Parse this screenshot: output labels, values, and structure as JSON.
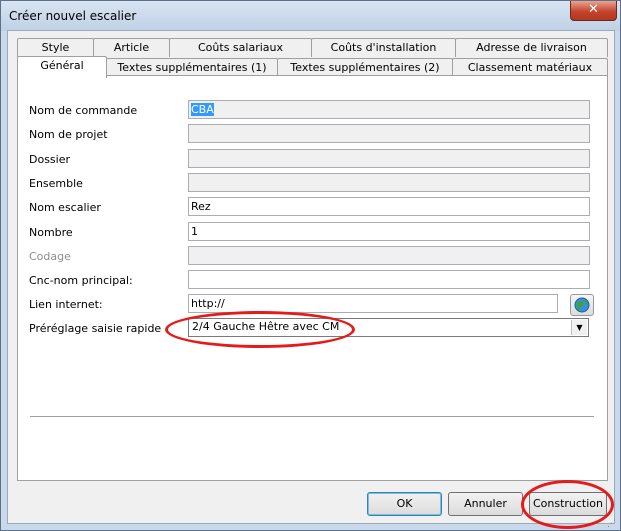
{
  "window": {
    "title": "Créer nouvel escalier",
    "close_label": "✕"
  },
  "tabs": {
    "row1": [
      "Style",
      "Article",
      "Coûts salariaux",
      "Coûts d'installation",
      "Adresse de livraison"
    ],
    "row2": [
      "Général",
      "Textes supplémentaires (1)",
      "Textes supplémentaires (2)",
      "Classement matériaux"
    ],
    "active": "Général"
  },
  "form": {
    "nom_commande": {
      "label": "Nom de commande",
      "value": "CBA"
    },
    "nom_projet": {
      "label": "Nom de projet",
      "value": ""
    },
    "dossier": {
      "label": "Dossier",
      "value": ""
    },
    "ensemble": {
      "label": "Ensemble",
      "value": ""
    },
    "nom_escalier": {
      "label": "Nom escalier",
      "value": "Rez"
    },
    "nombre": {
      "label": "Nombre",
      "value": "1"
    },
    "codage": {
      "label": "Codage",
      "value": ""
    },
    "cnc_nom": {
      "label": "Cnc-nom principal:",
      "value": ""
    },
    "lien_internet": {
      "label": "Lien internet:",
      "value": "http://"
    },
    "preset": {
      "label": "Préréglage saisie rapide",
      "value": "2/4 Gauche Hêtre avec CM"
    }
  },
  "buttons": {
    "ok": "OK",
    "annuler": "Annuler",
    "construction": "Construction"
  },
  "icons": {
    "globe": "globe-icon",
    "dropdown": "chevron-down-icon"
  },
  "colors": {
    "highlight_ring": "#e51a1a",
    "selection": "#3399ff"
  }
}
